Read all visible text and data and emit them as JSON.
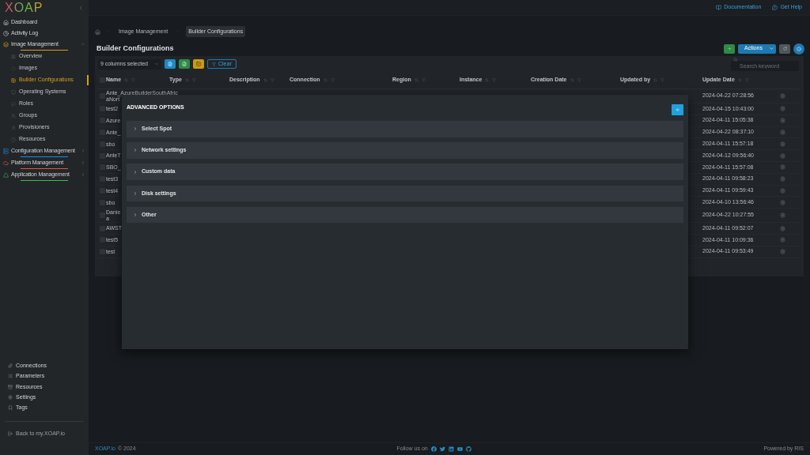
{
  "sidebar": {
    "logo": "XOAP",
    "nav": [
      {
        "kind": "link",
        "label": "Dashboard",
        "selected": false
      },
      {
        "kind": "link",
        "label": "Activity Log",
        "selected": false
      },
      {
        "kind": "group",
        "label": "Image Management",
        "expanded": true,
        "color": "#d4a017",
        "children": [
          {
            "label": "Overview",
            "selected": false
          },
          {
            "label": "Images",
            "selected": false
          },
          {
            "label": "Builder Configurations",
            "selected": true
          },
          {
            "label": "Operating Systems",
            "selected": false
          },
          {
            "label": "Roles",
            "selected": false
          },
          {
            "label": "Groups",
            "selected": false
          },
          {
            "label": "Provisioners",
            "selected": false
          },
          {
            "label": "Resources",
            "selected": false
          }
        ]
      },
      {
        "kind": "group",
        "label": "Configuration Management",
        "expanded": false,
        "color": "#1e88e5"
      },
      {
        "kind": "group",
        "label": "Platform Management",
        "expanded": false,
        "color": "#e0583a"
      },
      {
        "kind": "group",
        "label": "Application Management",
        "expanded": false,
        "color": "#3fb950"
      }
    ],
    "bottom": [
      "Connections",
      "Parameters",
      "Resources",
      "Settings",
      "Tags"
    ],
    "back": "Back to my.XOAP.io"
  },
  "header": {
    "links": [
      "Documentation",
      "Get Help"
    ]
  },
  "breadcrumb": [
    {
      "label": "Image Management",
      "selected": false
    },
    {
      "label": "Builder Configurations",
      "selected": true
    }
  ],
  "title": "Builder Configurations",
  "actions": {
    "label": "Actions"
  },
  "toolbar": {
    "columns": "9 columns selected",
    "clear": "Clear",
    "search_placeholder": "Search keyword"
  },
  "table": {
    "all_checked": false,
    "columns": [
      "Name",
      "Type",
      "Description",
      "Connection",
      "Region",
      "Instance",
      "Creation Date",
      "Updated by",
      "Update Date"
    ],
    "rows": [
      {
        "checked": false,
        "name": "Ante_AzureBuilderSouthAfric",
        "name_2": "aNort",
        "update": "2024-04-22 07:28:56"
      },
      {
        "checked": false,
        "name": "test2",
        "update": "2024-04-15 10:43:00"
      },
      {
        "checked": false,
        "name": "Azure",
        "update": "2024-04-11 15:05:38"
      },
      {
        "checked": false,
        "name": "Ante_",
        "update": "2024-04-22 08:37:10"
      },
      {
        "checked": false,
        "name": "sbo",
        "update": "2024-04-11 15:57:18"
      },
      {
        "checked": false,
        "name": "AnteT",
        "update": "2024-04-12 09:56:40"
      },
      {
        "checked": false,
        "name": "SBO_",
        "update": "2024-04-11 15:57:08"
      },
      {
        "checked": false,
        "name": "test3",
        "update": "2024-04-11 09:58:23"
      },
      {
        "checked": false,
        "name": "test4",
        "update": "2024-04-11 09:59:43"
      },
      {
        "checked": false,
        "name": "sbo",
        "update": "2024-04-10 13:56:46"
      },
      {
        "checked": false,
        "name": "Danie",
        "name_2": "a",
        "update": "2024-04-22 10:27:55"
      },
      {
        "checked": false,
        "name": "AWST",
        "update": "2024-04-11 09:52:07"
      },
      {
        "checked": false,
        "name": "test5",
        "update": "2024-04-11 10:09:36"
      },
      {
        "checked": false,
        "name": "test",
        "update": "2024-04-11 09:53:49"
      }
    ]
  },
  "modal": {
    "title": "ADVANCED OPTIONS",
    "sections": [
      {
        "label": "Select Spot",
        "expanded": false
      },
      {
        "label": "Network settings",
        "expanded": false
      },
      {
        "label": "Custom data",
        "expanded": false
      },
      {
        "label": "Disk settings",
        "expanded": false
      },
      {
        "label": "Other",
        "expanded": false
      }
    ]
  },
  "footer": {
    "brand": "XOAP.io",
    "copyright": "© 2024",
    "follow": "Follow us on",
    "powered": "Powered by RIS"
  }
}
